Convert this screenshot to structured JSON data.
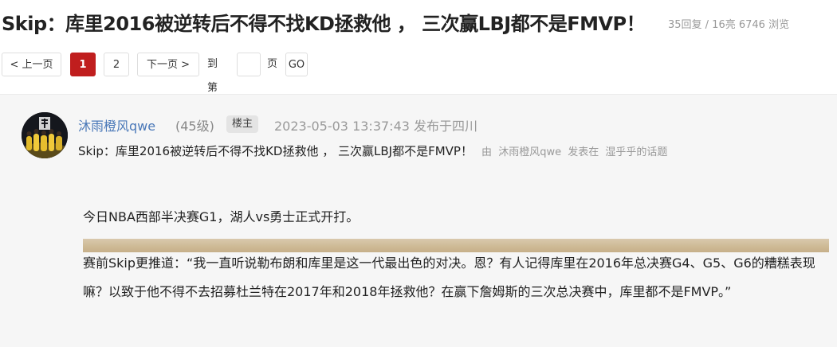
{
  "header": {
    "title": "Skip：库里2016被逆转后不得不找KD拯救他 ， 三次赢LBJ都不是FMVP！",
    "stats": "35回复 / 16亮 6746 浏览"
  },
  "pager": {
    "prev": "< 上一页",
    "pages": [
      "1",
      "2"
    ],
    "active_page": "1",
    "next": "下一页 >",
    "goto_label": "到第",
    "page_unit": "页",
    "go": "GO"
  },
  "post": {
    "author": "沐雨橙风qwe",
    "level": "(45级)",
    "badge": "楼主",
    "time_location": "2023-05-03 13:37:43 发布于四川",
    "summary": "Skip：库里2016被逆转后不得不找KD拯救他 ， 三次赢LBJ都不是FMVP！",
    "source_by": "由",
    "source_author": "沐雨橙风qwe",
    "source_posted": "发表在",
    "source_topic": "湿乎乎的话题",
    "paragraphs": [
      "今日NBA西部半决赛G1，湖人vs勇士正式开打。",
      "赛前Skip更推道：“我一直听说勒布朗和库里是这一代最出色的对决。恩？有人记得库里在2016年总决赛G4、G5、G6的糟糕表现嘛？以致于他不得不去招募杜兰特在2017年和2018年拯救他？在赢下詹姆斯的三次总决赛中，库里都不是FMVP。”"
    ]
  },
  "colors": {
    "accent": "#c01e1e",
    "link": "#4a78b8",
    "muted": "#999999",
    "post_bg": "#f6f6f6"
  }
}
